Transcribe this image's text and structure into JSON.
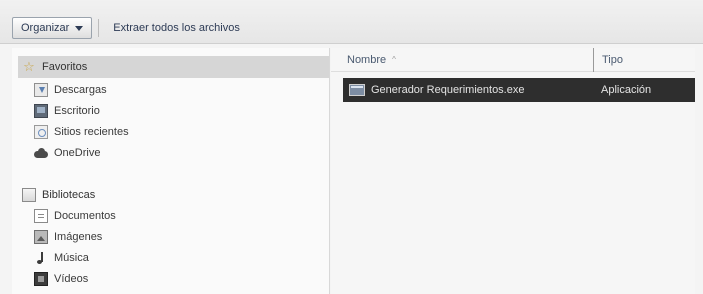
{
  "toolbar": {
    "organize_label": "Organizar",
    "extract_label": "Extraer todos los archivos"
  },
  "nav": {
    "favorites": {
      "label": "Favoritos",
      "items": [
        {
          "label": "Descargas",
          "icon": "downloads-icon"
        },
        {
          "label": "Escritorio",
          "icon": "desktop-icon"
        },
        {
          "label": "Sitios recientes",
          "icon": "recent-places-icon"
        },
        {
          "label": "OneDrive",
          "icon": "onedrive-icon"
        }
      ]
    },
    "libraries": {
      "label": "Bibliotecas",
      "items": [
        {
          "label": "Documentos",
          "icon": "documents-icon"
        },
        {
          "label": "Imágenes",
          "icon": "pictures-icon"
        },
        {
          "label": "Música",
          "icon": "music-icon"
        },
        {
          "label": "Vídeos",
          "icon": "videos-icon"
        }
      ]
    }
  },
  "content": {
    "columns": {
      "name": "Nombre",
      "type": "Tipo"
    },
    "files": [
      {
        "name": "Generador Requerimientos.exe",
        "type": "Aplicación",
        "selected": true
      }
    ]
  },
  "colors": {
    "selected_row": "#2e2e2e",
    "nav_selected": "#d6d6d6"
  }
}
